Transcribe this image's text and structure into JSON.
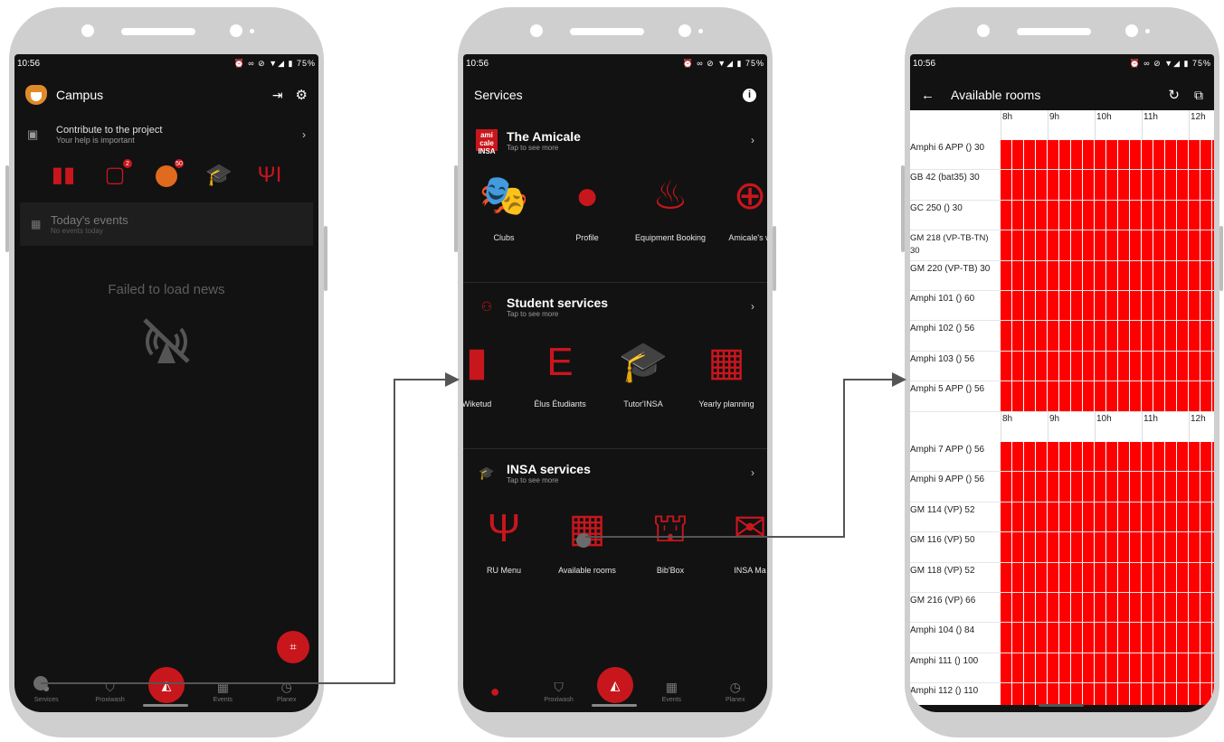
{
  "colors": {
    "accent": "#c8161d",
    "grid_busy": "#ff0000",
    "screen_bg": "#121212"
  },
  "status": {
    "time": "10:56",
    "right": "⏰ ∞ ⊘ ▼◢ ▮ 75%"
  },
  "screen1": {
    "title": "Campus",
    "contribute": {
      "title": "Contribute to the project",
      "subtitle": "Your help is important"
    },
    "dashboard_badges": {
      "washer": "2",
      "proximo": "50"
    },
    "events": {
      "title": "Today's events",
      "subtitle": "No events today"
    },
    "failed": "Failed to load news",
    "nav": [
      "Services",
      "Proxiwash",
      "Events",
      "Planex"
    ]
  },
  "screen2": {
    "title": "Services",
    "amicale": {
      "title": "The Amicale",
      "subtitle": "Tap to see more",
      "logo": "ami cale INSA",
      "tiles": [
        "Clubs",
        "Profile",
        "Equipment Booking",
        "Amicale's w"
      ]
    },
    "student": {
      "title": "Student services",
      "subtitle": "Tap to see more",
      "tiles": [
        "Wiketud",
        "Élus Étudiants",
        "Tutor'INSA",
        "Yearly planning"
      ]
    },
    "insa": {
      "title": "INSA services",
      "subtitle": "Tap to see more",
      "tiles": [
        "RU Menu",
        "Available rooms",
        "Bib'Box",
        "INSA Ma"
      ]
    },
    "nav": [
      "Proxiwash",
      "Events",
      "Planex"
    ]
  },
  "screen3": {
    "title": "Available rooms",
    "hours": [
      "8h",
      "9h",
      "10h",
      "11h",
      "12h"
    ],
    "group1": [
      "Amphi 6 APP () 30",
      "GB 42 (bat35) 30",
      "GC 250 () 30",
      "GM 218 (VP-TB-TN) 30",
      "GM 220 (VP-TB) 30",
      "Amphi 101 () 60",
      "Amphi 102 () 56",
      "Amphi 103 () 56",
      "Amphi 5 APP () 56"
    ],
    "group2": [
      "Amphi 7 APP () 56",
      "Amphi 9 APP () 56",
      "GM 114 (VP) 52",
      "GM 116 (VP) 50",
      "GM 118 (VP) 52",
      "GM 216 (VP) 66",
      "Amphi 104 () 84",
      "Amphi 111 () 100",
      "Amphi 112 () 110"
    ]
  }
}
